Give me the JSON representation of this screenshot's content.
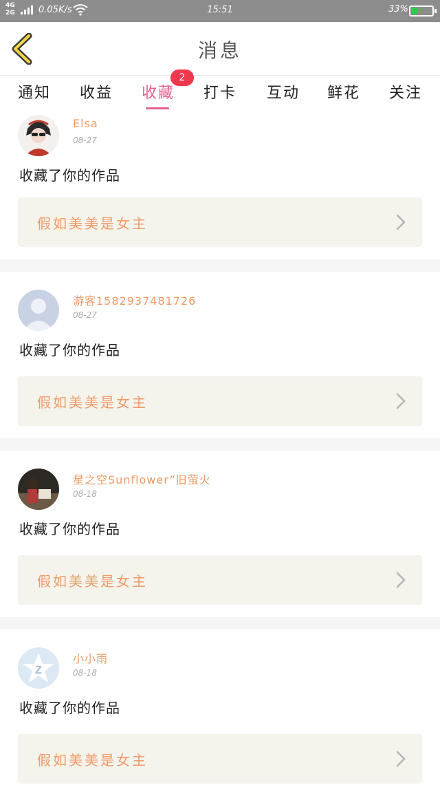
{
  "status_bar": {
    "network": "4G\n2G",
    "speed": "0.05K/s",
    "time": "15:51",
    "battery_pct": "33%",
    "battery_level": 0.33
  },
  "header": {
    "title": "消息"
  },
  "tabs": [
    {
      "label": "通知"
    },
    {
      "label": "收益"
    },
    {
      "label": "收藏",
      "active": true,
      "badge": "2"
    },
    {
      "label": "打卡"
    },
    {
      "label": "互动"
    },
    {
      "label": "鲜花"
    },
    {
      "label": "关注"
    }
  ],
  "colors": {
    "accent": "#e35f8f",
    "username": "#f09a67",
    "badge": "#f0384f",
    "work_bg": "#f4f3ec"
  },
  "feed": [
    {
      "username": "Elsa",
      "date": "08-27",
      "action": "收藏了你的作品",
      "work": "假如美美是女主",
      "avatar_icon": "user-photo-avatar"
    },
    {
      "username": "游客15829374817​26",
      "date": "08-27",
      "action": "收藏了你的作品",
      "work": "假如美美是女主",
      "avatar_icon": "default-user-avatar"
    },
    {
      "username": "星之空Sunflower”旧萤火",
      "date": "08-18",
      "action": "收藏了你的作品",
      "work": "假如美美是女主",
      "avatar_icon": "user-photo-avatar"
    },
    {
      "username": "小小雨",
      "date": "08-18",
      "action": "收藏了你的作品",
      "work": "假如美美是女主",
      "avatar_icon": "qzone-avatar"
    }
  ]
}
